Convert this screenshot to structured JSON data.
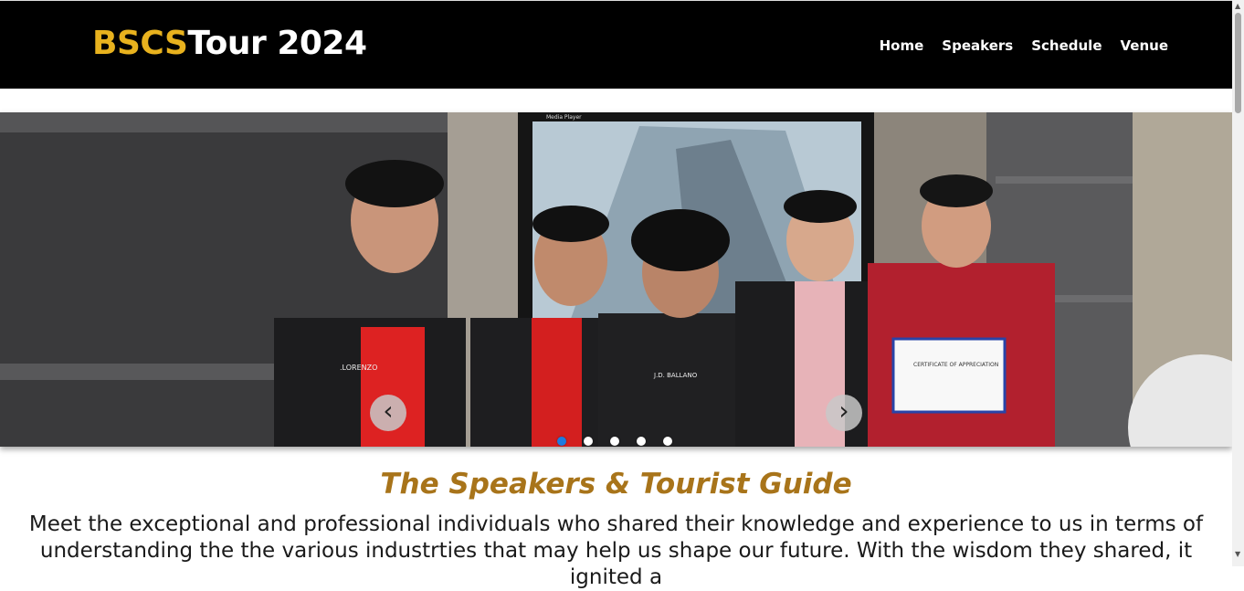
{
  "brand": {
    "part1": "BSCS",
    "part2": "Tour 2024"
  },
  "nav": {
    "items": [
      "Home",
      "Speakers",
      "Schedule",
      "Venue"
    ]
  },
  "carousel": {
    "prev_label": "‹",
    "next_label": "›",
    "slides": 5,
    "active_slide": 1,
    "photo_text": {
      "player": "Media Player",
      "name1": ".LORENZO",
      "name2": "J.D. BALLANO",
      "certificate": "CERTIFICATE OF APPRECIATION"
    }
  },
  "section": {
    "title": "The Speakers & Tourist Guide",
    "description": "Meet the exceptional and professional individuals who shared their knowledge and experience to us in terms of understanding the the various industrties that may help us shape our future. With the wisdom they shared, it ignited a"
  },
  "colors": {
    "brand_accent": "#e8b21e",
    "title_color": "#a8741a",
    "active_dot": "#1e7be0",
    "header_bg": "#000000"
  }
}
